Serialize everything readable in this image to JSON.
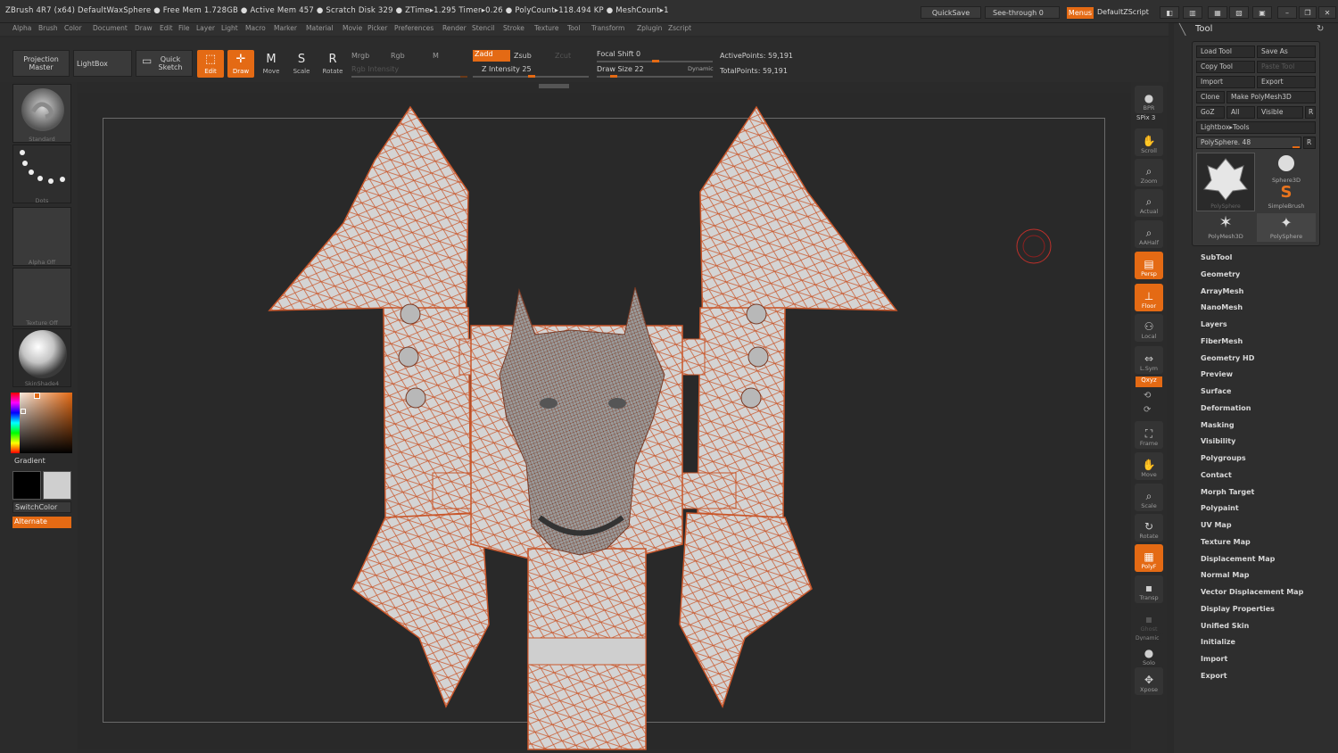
{
  "title_bar": {
    "text": "ZBrush 4R7 (x64)   DefaultWaxSphere   ● Free Mem 1.728GB ● Active Mem 457 ● Scratch Disk 329 ●  ZTime▸1.295 Timer▸0.26 ● PolyCount▸118.494 KP  ● MeshCount▸1",
    "quicksave": "QuickSave",
    "see_through": "See-through  0",
    "menus": "Menus",
    "zscript": "DefaultZScript"
  },
  "menu": [
    "Alpha",
    "Brush",
    "Color",
    "Document",
    "Draw",
    "Edit",
    "File",
    "Layer",
    "Light",
    "Macro",
    "Marker",
    "Material",
    "Movie",
    "Picker",
    "Preferences",
    "Render",
    "Stencil",
    "Stroke",
    "Texture",
    "Tool",
    "Transform",
    "Zplugin",
    "Zscript"
  ],
  "toolbar": {
    "projection_master": "Projection Master",
    "lightbox": "LightBox",
    "quick_sketch": "Quick Sketch",
    "edit": "Edit",
    "draw": "Draw",
    "move": "Move",
    "scale": "Scale",
    "rotate": "Rotate",
    "mrgb": "Mrgb",
    "rgb": "Rgb",
    "m": "M",
    "rgb_intensity": "Rgb Intensity",
    "zadd": "Zadd",
    "zsub": "Zsub",
    "zcut": "Zcut",
    "z_intensity": "Z Intensity 25",
    "focal_shift": "Focal Shift 0",
    "draw_size": "Draw Size 22",
    "dynamic": "Dynamic",
    "active_points": "ActivePoints: 59,191",
    "total_points": "TotalPoints: 59,191"
  },
  "left_shelf": {
    "brush": "Standard",
    "stroke": "Dots",
    "alpha": "Alpha Off",
    "texture": "Texture Off",
    "material": "SkinShade4",
    "gradient": "Gradient",
    "switch_color": "SwitchColor",
    "alternate": "Alternate"
  },
  "right_shelf": {
    "bpr": "BPR",
    "spix": "SPix 3",
    "scroll": "Scroll",
    "zoom": "Zoom",
    "actual": "Actual",
    "aahalf": "AAHalf",
    "persp": "Persp",
    "floor": "Floor",
    "local": "Local",
    "lsym": "L.Sym",
    "xyz": "Qxyz",
    "frame": "Frame",
    "move": "Move",
    "scale": "Scale",
    "rotate": "Rotate",
    "polyf": "PolyF",
    "transp": "Transp",
    "ghost": "Ghost",
    "dynamic": "Dynamic",
    "solo": "Solo",
    "xpose": "Xpose"
  },
  "tool_panel": {
    "title": "Tool",
    "load_tool": "Load Tool",
    "save_as": "Save As",
    "copy_tool": "Copy Tool",
    "paste_tool": "Paste Tool",
    "import": "Import",
    "export": "Export",
    "clone": "Clone",
    "make_polymesh": "Make PolyMesh3D",
    "goz": "GoZ",
    "all": "All",
    "visible": "Visible",
    "r": "R",
    "lightbox_tools": "Lightbox▸Tools",
    "polysphere_slider": "PolySphere. 48",
    "r2": "R",
    "thumbs": [
      "PolySphere",
      "Sphere3D",
      "SimpleBrush",
      "PolyMesh3D",
      "PolySphere"
    ],
    "sections": [
      "SubTool",
      "Geometry",
      "ArrayMesh",
      "NanoMesh",
      "Layers",
      "FiberMesh",
      "Geometry HD",
      "Preview",
      "Surface",
      "Deformation",
      "Masking",
      "Visibility",
      "Polygroups",
      "Contact",
      "Morph Target",
      "Polypaint",
      "UV Map",
      "Texture Map",
      "Displacement Map",
      "Normal Map",
      "Vector Displacement Map",
      "Display Properties",
      "Unified Skin",
      "Initialize",
      "Import",
      "Export"
    ]
  },
  "colors": {
    "accent": "#e46a14",
    "wire": "#c9562a",
    "mesh": "#cfcfcf"
  }
}
